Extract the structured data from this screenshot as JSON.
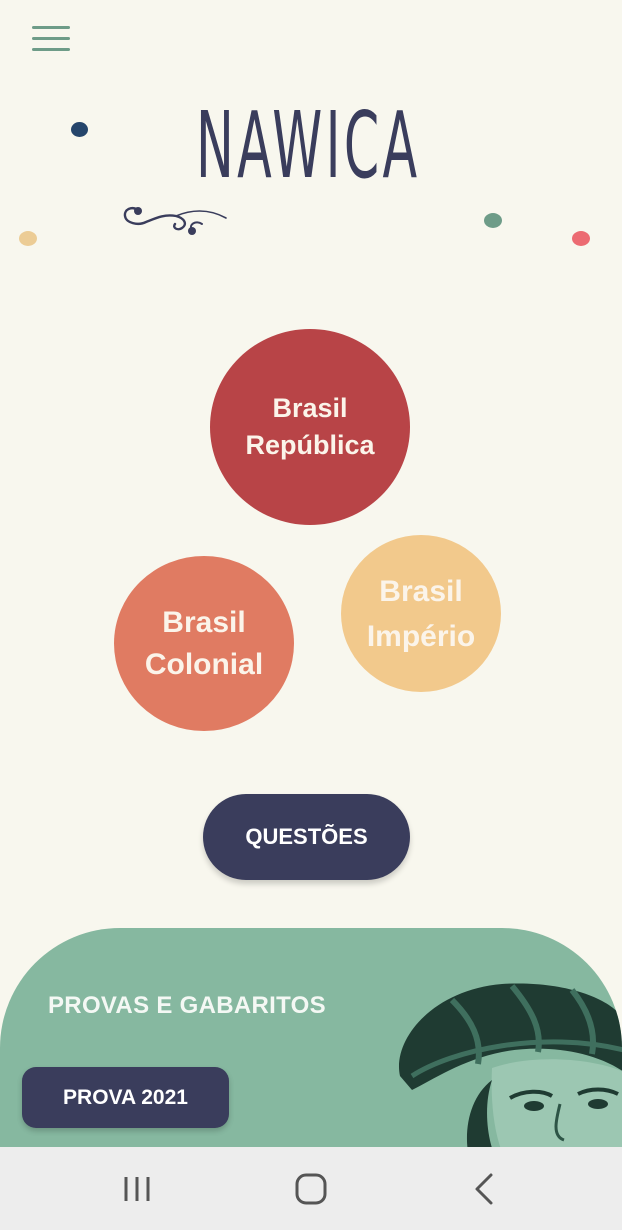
{
  "app": {
    "logo_text": "NAWICA"
  },
  "colors": {
    "background": "#f8f7ee",
    "navy": "#3a3d5c",
    "green": "#86b8a0",
    "republica": "#b84447",
    "colonial": "#e07b62",
    "imperio": "#f2c98c"
  },
  "eras": [
    {
      "lines": [
        "Brasil",
        "República"
      ]
    },
    {
      "lines": [
        "Brasil",
        "Colonial"
      ]
    },
    {
      "lines": [
        "Brasil",
        "Império"
      ]
    }
  ],
  "buttons": {
    "questoes": "QUESTÕES",
    "prova": "PROVA 2021"
  },
  "provas": {
    "title": "PROVAS E GABARITOS"
  },
  "icons": {
    "menu": "hamburger-menu-icon",
    "recent": "recent-apps-icon",
    "home": "home-icon",
    "back": "back-icon"
  }
}
